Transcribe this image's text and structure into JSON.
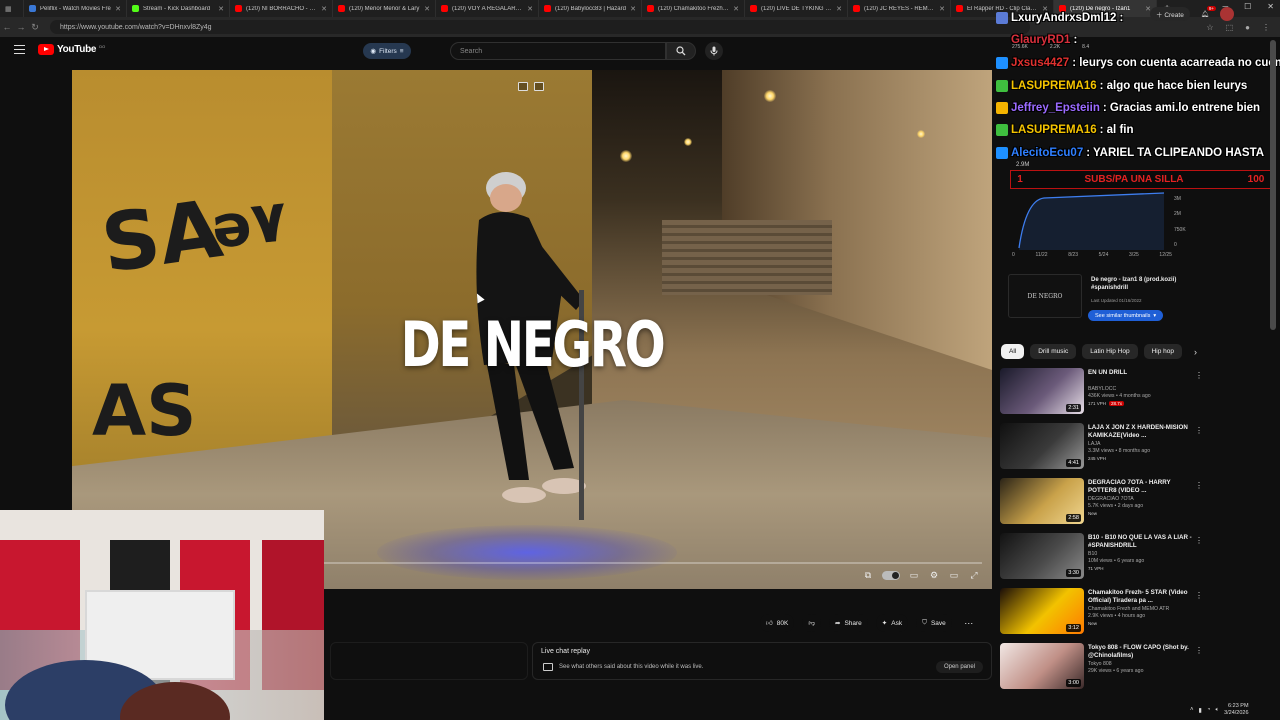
{
  "browser": {
    "tabs": [
      {
        "label": "Peliflix - Watch Movies Fre",
        "color": "#3a78d6",
        "active": false
      },
      {
        "label": "Stream - Kick Dashboard",
        "color": "#53fc18",
        "active": false
      },
      {
        "label": "(120) NI BORRACHO - Que",
        "color": "#ff0000",
        "active": false
      },
      {
        "label": "(120) Menor Menor & Lary",
        "color": "#ff0000",
        "active": false
      },
      {
        "label": "(120) VOY A REGALAR ESTE",
        "color": "#ff0000",
        "active": false
      },
      {
        "label": "(120) Babylocc83 | Hazard",
        "color": "#ff0000",
        "active": false
      },
      {
        "label": "(120) Chamakitoo Frezh- 5",
        "color": "#ff0000",
        "active": false
      },
      {
        "label": "(120) LIVE DE TYKING CON",
        "color": "#ff0000",
        "active": false
      },
      {
        "label": "(120) JC REYES - REMEDIO",
        "color": "#ff0000",
        "active": false
      },
      {
        "label": "El Rapper RD - Clip Clap W",
        "color": "#ff0000",
        "active": false
      },
      {
        "label": "(120) De negro - Izan1",
        "color": "#ff0000",
        "active": true
      }
    ],
    "url": "https://www.youtube.com/watch?v=DHnxvl8Zy4g"
  },
  "youtube": {
    "logo_text": "YouTube",
    "logo_sup": "DO",
    "filters_label": "Filters",
    "search_placeholder": "Search",
    "create_label": "Create",
    "notif_count": "9+"
  },
  "video": {
    "title_overlay": "DE NEGRO"
  },
  "actions": {
    "likes": "80K",
    "share": "Share",
    "ask": "Ask",
    "save": "Save"
  },
  "live_chat": {
    "title": "Live chat replay",
    "description": "See what others said about this video while it was live.",
    "open_button": "Open panel"
  },
  "chat_overlay": [
    {
      "user": "LxuryAndrxsDml12",
      "message": ":",
      "user_color": "#ffffff",
      "badge_color": "#5b7bd6"
    },
    {
      "user": "GlauryRD1",
      "message": ":",
      "user_color": "#d9303c",
      "badge_color": "#00000000"
    },
    {
      "user": "Jxsus4427",
      "message": ": leurys con cuenta acarreada no cuen",
      "user_color": "#e0312f",
      "badge_color": "#1e90ff"
    },
    {
      "user": "LASUPREMA16",
      "message": ": algo que hace bien leurys",
      "user_color": "#f5c400",
      "badge_color": "#3fbf3f"
    },
    {
      "user": "Jeffrey_Epsteiin",
      "message": ": Gracias ami.lo entrene bien",
      "user_color": "#9b6bff",
      "badge_color": "#f5b400"
    },
    {
      "user": "LASUPREMA16",
      "message": ": al fin",
      "user_color": "#f5c400",
      "badge_color": "#3fbf3f"
    },
    {
      "user": "AlecitoEcu07",
      "message": ": YARIEL TA CLIPEANDO HASTA",
      "user_color": "#2f7fff",
      "badge_color": "#1e90ff"
    }
  ],
  "sub_goal": {
    "left": "1",
    "text": "SUBS/PA UNA SILLA",
    "right": "100"
  },
  "analytics": {
    "stats": [
      "275.6K",
      "2.2K",
      "8.4"
    ],
    "total_views": "2.9M",
    "x_ticks": [
      "0",
      "11/22",
      "8/23",
      "5/24",
      "3/25",
      "12/25"
    ],
    "y_ticks": [
      "3M",
      "2M",
      "750K",
      "0"
    ]
  },
  "promo": {
    "thumb_text": "DE NEGRO",
    "title": "De negro - Izan1 8 (prod.kozii) #spanishdrill",
    "meta": "Last Updated 01/16/2022",
    "button": "See similar thumbnails"
  },
  "chips": [
    "All",
    "Drill music",
    "Latin Hip Hop",
    "Hip hop"
  ],
  "recommendations": [
    {
      "title": "EN UN DRILL",
      "channel": "BABYLOCC",
      "views": "436K views • 4 months ago",
      "badge": "171 VPH",
      "badge2": "28.7x",
      "duration": "2:31",
      "colors": [
        "#1a1a2a",
        "#6b5a7a",
        "#e8dfe8"
      ]
    },
    {
      "title": "LAJA X JON Z X HARDEN-MISION KAMIKAZE(Video ...",
      "channel": "LAJA",
      "views": "3.3M views • 8 months ago",
      "badge": "245 VPH",
      "badge2": "",
      "duration": "4:41",
      "colors": [
        "#101010",
        "#3a3a3a",
        "#9a9a9a"
      ]
    },
    {
      "title": "DEGRACIAO 7OTA - HARRY POTTER8 (VIDEO ...",
      "channel": "DEGRACIAO 7OTA",
      "views": "5.7K views • 2 days ago",
      "badge": "New",
      "badge2": "",
      "duration": "2:58",
      "colors": [
        "#2b2417",
        "#c9a24a",
        "#f0d690"
      ]
    },
    {
      "title": "B10 - B10 NO QUE LA VAS A LIAR - #SPANISHDRILL",
      "channel": "B10",
      "views": "10M views • 6 years ago",
      "badge": "71 VPH",
      "badge2": "",
      "duration": "3:30",
      "colors": [
        "#121212",
        "#4a4a4a",
        "#8b8b8b"
      ]
    },
    {
      "title": "Chamakitoo Frezh- 5 STAR (Video Official) Tiradera pa ...",
      "channel": "Chamakitoo Frezh and MEMO ATR",
      "views": "2.9K views • 4 hours ago",
      "badge": "New",
      "badge2": "",
      "duration": "3:12",
      "colors": [
        "#1a0d08",
        "#f2c200",
        "#ff7a00"
      ]
    },
    {
      "title": "Tokyo 808 - FLOW CAPO (Shot by. @Chinolafilms)",
      "channel": "Tokyo 808",
      "views": "29K views • 6 years ago",
      "badge": "",
      "badge2": "",
      "duration": "3:00",
      "colors": [
        "#f1e7e4",
        "#c08f86",
        "#3b2a2a"
      ]
    }
  ],
  "system": {
    "time": "6:23 PM",
    "date": "3/24/2026"
  }
}
